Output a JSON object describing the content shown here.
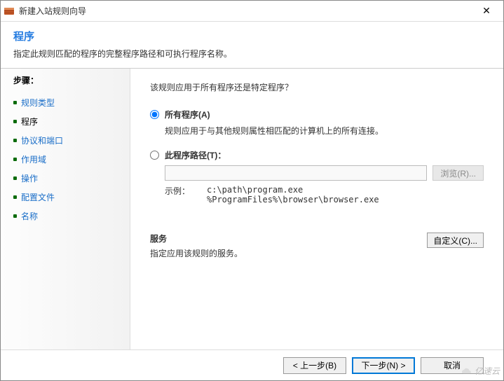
{
  "titlebar": {
    "title": "新建入站规则向导"
  },
  "header": {
    "heading": "程序",
    "subtitle": "指定此规则匹配的程序的完整程序路径和可执行程序名称。"
  },
  "sidebar": {
    "title": "步骤：",
    "items": [
      {
        "label": "规则类型",
        "current": false
      },
      {
        "label": "程序",
        "current": true
      },
      {
        "label": "协议和端口",
        "current": false
      },
      {
        "label": "作用域",
        "current": false
      },
      {
        "label": "操作",
        "current": false
      },
      {
        "label": "配置文件",
        "current": false
      },
      {
        "label": "名称",
        "current": false
      }
    ]
  },
  "main": {
    "question": "该规则应用于所有程序还是特定程序？",
    "optAll": {
      "label": "所有程序(A)",
      "desc": "规则应用于与其他规则属性相匹配的计算机上的所有连接。"
    },
    "optPath": {
      "label": "此程序路径(T)：",
      "value": "",
      "browse": "浏览(R)..."
    },
    "example": {
      "label": "示例：",
      "text": "c:\\path\\program.exe\n%ProgramFiles%\\browser\\browser.exe"
    },
    "services": {
      "title": "服务",
      "desc": "指定应用该规则的服务。",
      "customize": "自定义(C)..."
    }
  },
  "footer": {
    "back": "< 上一步(B)",
    "next": "下一步(N) >",
    "cancel": "取消"
  },
  "watermark": "亿速云"
}
